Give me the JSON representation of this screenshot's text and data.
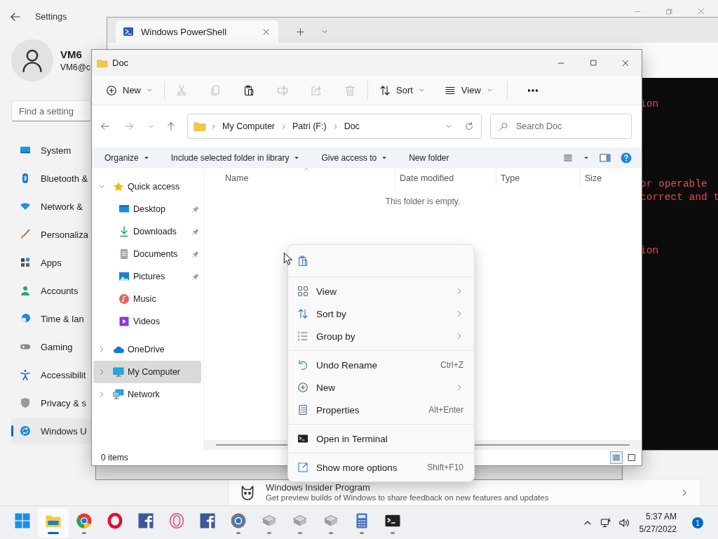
{
  "settings": {
    "title": "Settings",
    "user": {
      "name": "VM6",
      "email": "VM6@c"
    },
    "search": {
      "placeholder": "Find a setting"
    },
    "nav": [
      {
        "label": "System",
        "kind": "system",
        "selected": false
      },
      {
        "label": "Bluetooth &",
        "kind": "bluetooth",
        "selected": false
      },
      {
        "label": "Network &",
        "kind": "network",
        "selected": false
      },
      {
        "label": "Personaliza",
        "kind": "personalization",
        "selected": false
      },
      {
        "label": "Apps",
        "kind": "apps",
        "selected": false
      },
      {
        "label": "Accounts",
        "kind": "accounts",
        "selected": false
      },
      {
        "label": "Time & lan",
        "kind": "time",
        "selected": false
      },
      {
        "label": "Gaming",
        "kind": "gaming",
        "selected": false
      },
      {
        "label": "Accessibilit",
        "kind": "accessibility",
        "selected": false
      },
      {
        "label": "Privacy & s",
        "kind": "privacy",
        "selected": false
      },
      {
        "label": "Windows U",
        "kind": "update",
        "selected": true
      }
    ],
    "insider_card": {
      "title": "Windows Insider Program",
      "description": "Get preview builds of Windows to share feedback on new features and updates"
    }
  },
  "terminal": {
    "tab_title": "Windows PowerShell",
    "output_lines": [
      "ion",
      "or operable",
      "correct and t",
      "ion"
    ]
  },
  "explorer": {
    "title": "Doc",
    "command_bar": [
      {
        "kind": "new",
        "label": "New",
        "disabled": false
      },
      {
        "kind": "cut",
        "disabled": true
      },
      {
        "kind": "copy",
        "disabled": true
      },
      {
        "kind": "paste",
        "disabled": false
      },
      {
        "kind": "rename",
        "disabled": true
      },
      {
        "kind": "share",
        "disabled": true
      },
      {
        "kind": "delete",
        "disabled": true
      },
      {
        "kind": "sort",
        "label": "Sort",
        "disabled": false
      },
      {
        "kind": "view",
        "label": "View",
        "disabled": false
      },
      {
        "kind": "more",
        "disabled": false
      }
    ],
    "breadcrumb": [
      "My Computer",
      "Patri (F:)",
      "Doc"
    ],
    "search": {
      "placeholder": "Search Doc"
    },
    "ribbon": [
      {
        "label": "Organize",
        "dropdown": true
      },
      {
        "label": "Include selected folder in library",
        "dropdown": true
      },
      {
        "label": "Give access to",
        "dropdown": true
      },
      {
        "label": "New folder",
        "dropdown": false
      }
    ],
    "nav_tree": [
      {
        "label": "Quick access",
        "kind": "quick_access",
        "expanded": true,
        "selected": false,
        "children": [
          {
            "label": "Desktop",
            "kind": "desktop",
            "pinned": true,
            "selected": false
          },
          {
            "label": "Downloads",
            "kind": "downloads",
            "pinned": true,
            "selected": false
          },
          {
            "label": "Documents",
            "kind": "documents",
            "pinned": true,
            "selected": false
          },
          {
            "label": "Pictures",
            "kind": "pictures",
            "pinned": true,
            "selected": false
          },
          {
            "label": "Music",
            "kind": "music",
            "pinned": false,
            "selected": false
          },
          {
            "label": "Videos",
            "kind": "videos",
            "pinned": false,
            "selected": false
          }
        ]
      },
      {
        "label": "OneDrive",
        "kind": "onedrive",
        "expanded": false,
        "selected": false
      },
      {
        "label": "My Computer",
        "kind": "computer",
        "expanded": false,
        "selected": true
      },
      {
        "label": "Network",
        "kind": "network",
        "expanded": false,
        "selected": false
      }
    ],
    "columns": [
      "Name",
      "Date modified",
      "Type",
      "Size"
    ],
    "empty_message": "This folder is empty.",
    "status": "0 items",
    "view_modes": [
      {
        "kind": "details",
        "selected": true
      },
      {
        "kind": "large_icons",
        "selected": false
      }
    ]
  },
  "context_menu": {
    "groups": [
      [
        {
          "kind": "paste",
          "submenu": false
        }
      ],
      [
        {
          "kind": "view",
          "label": "View",
          "submenu": true
        },
        {
          "kind": "sort",
          "label": "Sort by",
          "submenu": true
        },
        {
          "kind": "group",
          "label": "Group by",
          "submenu": true
        }
      ],
      [
        {
          "kind": "undo",
          "label": "Undo Rename",
          "shortcut": "Ctrl+Z",
          "submenu": false
        },
        {
          "kind": "new",
          "label": "New",
          "submenu": true
        },
        {
          "kind": "properties",
          "label": "Properties",
          "shortcut": "Alt+Enter",
          "submenu": false
        }
      ],
      [
        {
          "kind": "terminal",
          "label": "Open in Terminal",
          "submenu": false
        }
      ],
      [
        {
          "kind": "more_options",
          "label": "Show more options",
          "shortcut": "Shift+F10",
          "submenu": false
        }
      ]
    ]
  },
  "taskbar": {
    "apps": [
      {
        "kind": "start",
        "running": false,
        "selected": false
      },
      {
        "kind": "explorer",
        "running": true,
        "selected": true
      },
      {
        "kind": "chrome",
        "running": true,
        "selected": false
      },
      {
        "kind": "opera",
        "running": false,
        "selected": false
      },
      {
        "kind": "facebook",
        "running": false,
        "selected": false
      },
      {
        "kind": "opera_gx",
        "running": false,
        "selected": false
      },
      {
        "kind": "facebook",
        "running": false,
        "selected": false
      },
      {
        "kind": "settings",
        "running": true,
        "selected": false
      },
      {
        "kind": "vm",
        "running": true,
        "selected": false
      },
      {
        "kind": "vm",
        "running": true,
        "selected": false
      },
      {
        "kind": "vm",
        "running": true,
        "selected": false
      },
      {
        "kind": "calculator",
        "running": true,
        "selected": false
      },
      {
        "kind": "terminal",
        "running": true,
        "selected": false
      }
    ],
    "clock": {
      "time": "5:37 AM",
      "date": "5/27/2022"
    },
    "notification_count": "1"
  }
}
